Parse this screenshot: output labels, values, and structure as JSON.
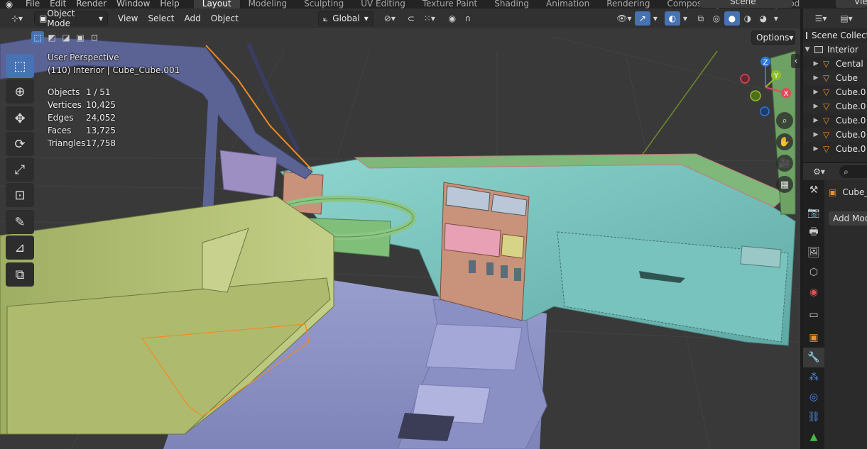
{
  "topbar": {
    "menus": [
      "File",
      "Edit",
      "Render",
      "Window",
      "Help"
    ],
    "workspaces": [
      "Layout",
      "Modeling",
      "Sculpting",
      "UV Editing",
      "Texture Paint",
      "Shading",
      "Animation",
      "Rendering",
      "Compositing",
      "Geometry Nod"
    ],
    "active_workspace": "Layout",
    "scene": "Scene",
    "view_layer": "Vie"
  },
  "viewport_header": {
    "mode": "Object Mode",
    "menus": [
      "View",
      "Select",
      "Add",
      "Object"
    ],
    "transform_orientation": "Global",
    "options_label": "Options"
  },
  "overlay": {
    "view_name": "User Perspective",
    "selection": "(110) Interior | Cube_Cube.001"
  },
  "stats": [
    {
      "label": "Objects",
      "value": "1 / 51"
    },
    {
      "label": "Vertices",
      "value": "10,425"
    },
    {
      "label": "Edges",
      "value": "24,052"
    },
    {
      "label": "Faces",
      "value": "13,725"
    },
    {
      "label": "Triangles",
      "value": "17,758"
    }
  ],
  "gizmo": {
    "x": "X",
    "y": "Y",
    "z": "Z"
  },
  "tools": [
    {
      "name": "select-box-tool",
      "glyph": "⬚",
      "active": true
    },
    {
      "name": "cursor-tool",
      "glyph": "⊕",
      "active": false
    },
    {
      "name": "move-tool",
      "glyph": "✥",
      "active": false
    },
    {
      "name": "rotate-tool",
      "glyph": "⟳",
      "active": false
    },
    {
      "name": "scale-tool",
      "glyph": "⤢",
      "active": false
    },
    {
      "name": "transform-tool",
      "glyph": "⊡",
      "active": false
    },
    {
      "name": "annotate-tool",
      "glyph": "✎",
      "active": false
    },
    {
      "name": "measure-tool",
      "glyph": "📐",
      "active": false
    },
    {
      "name": "add-cube-tool",
      "glyph": "⧉",
      "active": false
    }
  ],
  "outliner": {
    "root": "Scene Collection",
    "collection": "Interior",
    "items": [
      "Cental",
      "Cube",
      "Cube.0",
      "Cube.0",
      "Cube.0",
      "Cube.0",
      "Cube.0"
    ]
  },
  "properties": {
    "object_name": "Cube_",
    "add_modifier_label": "Add Modi"
  },
  "colors": {
    "accent": "#4772b3",
    "selection_outline": "#f08a24",
    "mesh_icon": "#e8912d"
  }
}
